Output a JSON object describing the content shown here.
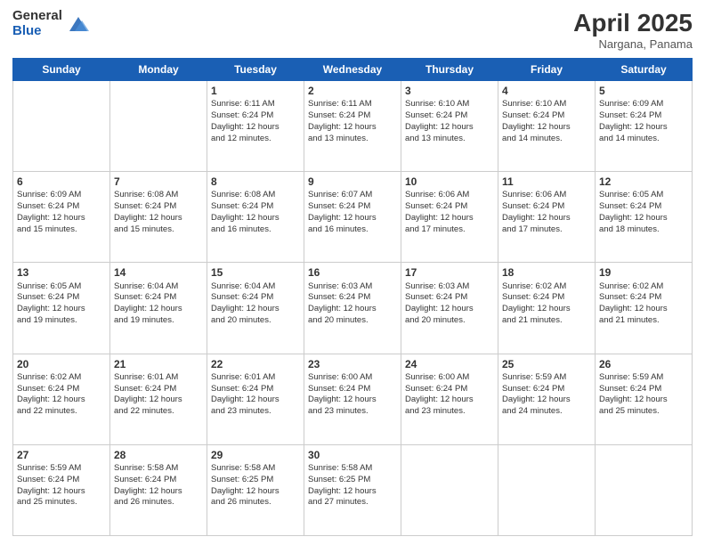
{
  "header": {
    "logo_general": "General",
    "logo_blue": "Blue",
    "month_title": "April 2025",
    "location": "Nargana, Panama"
  },
  "weekdays": [
    "Sunday",
    "Monday",
    "Tuesday",
    "Wednesday",
    "Thursday",
    "Friday",
    "Saturday"
  ],
  "rows": [
    [
      {
        "day": "",
        "lines": []
      },
      {
        "day": "",
        "lines": []
      },
      {
        "day": "1",
        "lines": [
          "Sunrise: 6:11 AM",
          "Sunset: 6:24 PM",
          "Daylight: 12 hours",
          "and 12 minutes."
        ]
      },
      {
        "day": "2",
        "lines": [
          "Sunrise: 6:11 AM",
          "Sunset: 6:24 PM",
          "Daylight: 12 hours",
          "and 13 minutes."
        ]
      },
      {
        "day": "3",
        "lines": [
          "Sunrise: 6:10 AM",
          "Sunset: 6:24 PM",
          "Daylight: 12 hours",
          "and 13 minutes."
        ]
      },
      {
        "day": "4",
        "lines": [
          "Sunrise: 6:10 AM",
          "Sunset: 6:24 PM",
          "Daylight: 12 hours",
          "and 14 minutes."
        ]
      },
      {
        "day": "5",
        "lines": [
          "Sunrise: 6:09 AM",
          "Sunset: 6:24 PM",
          "Daylight: 12 hours",
          "and 14 minutes."
        ]
      }
    ],
    [
      {
        "day": "6",
        "lines": [
          "Sunrise: 6:09 AM",
          "Sunset: 6:24 PM",
          "Daylight: 12 hours",
          "and 15 minutes."
        ]
      },
      {
        "day": "7",
        "lines": [
          "Sunrise: 6:08 AM",
          "Sunset: 6:24 PM",
          "Daylight: 12 hours",
          "and 15 minutes."
        ]
      },
      {
        "day": "8",
        "lines": [
          "Sunrise: 6:08 AM",
          "Sunset: 6:24 PM",
          "Daylight: 12 hours",
          "and 16 minutes."
        ]
      },
      {
        "day": "9",
        "lines": [
          "Sunrise: 6:07 AM",
          "Sunset: 6:24 PM",
          "Daylight: 12 hours",
          "and 16 minutes."
        ]
      },
      {
        "day": "10",
        "lines": [
          "Sunrise: 6:06 AM",
          "Sunset: 6:24 PM",
          "Daylight: 12 hours",
          "and 17 minutes."
        ]
      },
      {
        "day": "11",
        "lines": [
          "Sunrise: 6:06 AM",
          "Sunset: 6:24 PM",
          "Daylight: 12 hours",
          "and 17 minutes."
        ]
      },
      {
        "day": "12",
        "lines": [
          "Sunrise: 6:05 AM",
          "Sunset: 6:24 PM",
          "Daylight: 12 hours",
          "and 18 minutes."
        ]
      }
    ],
    [
      {
        "day": "13",
        "lines": [
          "Sunrise: 6:05 AM",
          "Sunset: 6:24 PM",
          "Daylight: 12 hours",
          "and 19 minutes."
        ]
      },
      {
        "day": "14",
        "lines": [
          "Sunrise: 6:04 AM",
          "Sunset: 6:24 PM",
          "Daylight: 12 hours",
          "and 19 minutes."
        ]
      },
      {
        "day": "15",
        "lines": [
          "Sunrise: 6:04 AM",
          "Sunset: 6:24 PM",
          "Daylight: 12 hours",
          "and 20 minutes."
        ]
      },
      {
        "day": "16",
        "lines": [
          "Sunrise: 6:03 AM",
          "Sunset: 6:24 PM",
          "Daylight: 12 hours",
          "and 20 minutes."
        ]
      },
      {
        "day": "17",
        "lines": [
          "Sunrise: 6:03 AM",
          "Sunset: 6:24 PM",
          "Daylight: 12 hours",
          "and 20 minutes."
        ]
      },
      {
        "day": "18",
        "lines": [
          "Sunrise: 6:02 AM",
          "Sunset: 6:24 PM",
          "Daylight: 12 hours",
          "and 21 minutes."
        ]
      },
      {
        "day": "19",
        "lines": [
          "Sunrise: 6:02 AM",
          "Sunset: 6:24 PM",
          "Daylight: 12 hours",
          "and 21 minutes."
        ]
      }
    ],
    [
      {
        "day": "20",
        "lines": [
          "Sunrise: 6:02 AM",
          "Sunset: 6:24 PM",
          "Daylight: 12 hours",
          "and 22 minutes."
        ]
      },
      {
        "day": "21",
        "lines": [
          "Sunrise: 6:01 AM",
          "Sunset: 6:24 PM",
          "Daylight: 12 hours",
          "and 22 minutes."
        ]
      },
      {
        "day": "22",
        "lines": [
          "Sunrise: 6:01 AM",
          "Sunset: 6:24 PM",
          "Daylight: 12 hours",
          "and 23 minutes."
        ]
      },
      {
        "day": "23",
        "lines": [
          "Sunrise: 6:00 AM",
          "Sunset: 6:24 PM",
          "Daylight: 12 hours",
          "and 23 minutes."
        ]
      },
      {
        "day": "24",
        "lines": [
          "Sunrise: 6:00 AM",
          "Sunset: 6:24 PM",
          "Daylight: 12 hours",
          "and 23 minutes."
        ]
      },
      {
        "day": "25",
        "lines": [
          "Sunrise: 5:59 AM",
          "Sunset: 6:24 PM",
          "Daylight: 12 hours",
          "and 24 minutes."
        ]
      },
      {
        "day": "26",
        "lines": [
          "Sunrise: 5:59 AM",
          "Sunset: 6:24 PM",
          "Daylight: 12 hours",
          "and 25 minutes."
        ]
      }
    ],
    [
      {
        "day": "27",
        "lines": [
          "Sunrise: 5:59 AM",
          "Sunset: 6:24 PM",
          "Daylight: 12 hours",
          "and 25 minutes."
        ]
      },
      {
        "day": "28",
        "lines": [
          "Sunrise: 5:58 AM",
          "Sunset: 6:24 PM",
          "Daylight: 12 hours",
          "and 26 minutes."
        ]
      },
      {
        "day": "29",
        "lines": [
          "Sunrise: 5:58 AM",
          "Sunset: 6:25 PM",
          "Daylight: 12 hours",
          "and 26 minutes."
        ]
      },
      {
        "day": "30",
        "lines": [
          "Sunrise: 5:58 AM",
          "Sunset: 6:25 PM",
          "Daylight: 12 hours",
          "and 27 minutes."
        ]
      },
      {
        "day": "",
        "lines": []
      },
      {
        "day": "",
        "lines": []
      },
      {
        "day": "",
        "lines": []
      }
    ]
  ]
}
